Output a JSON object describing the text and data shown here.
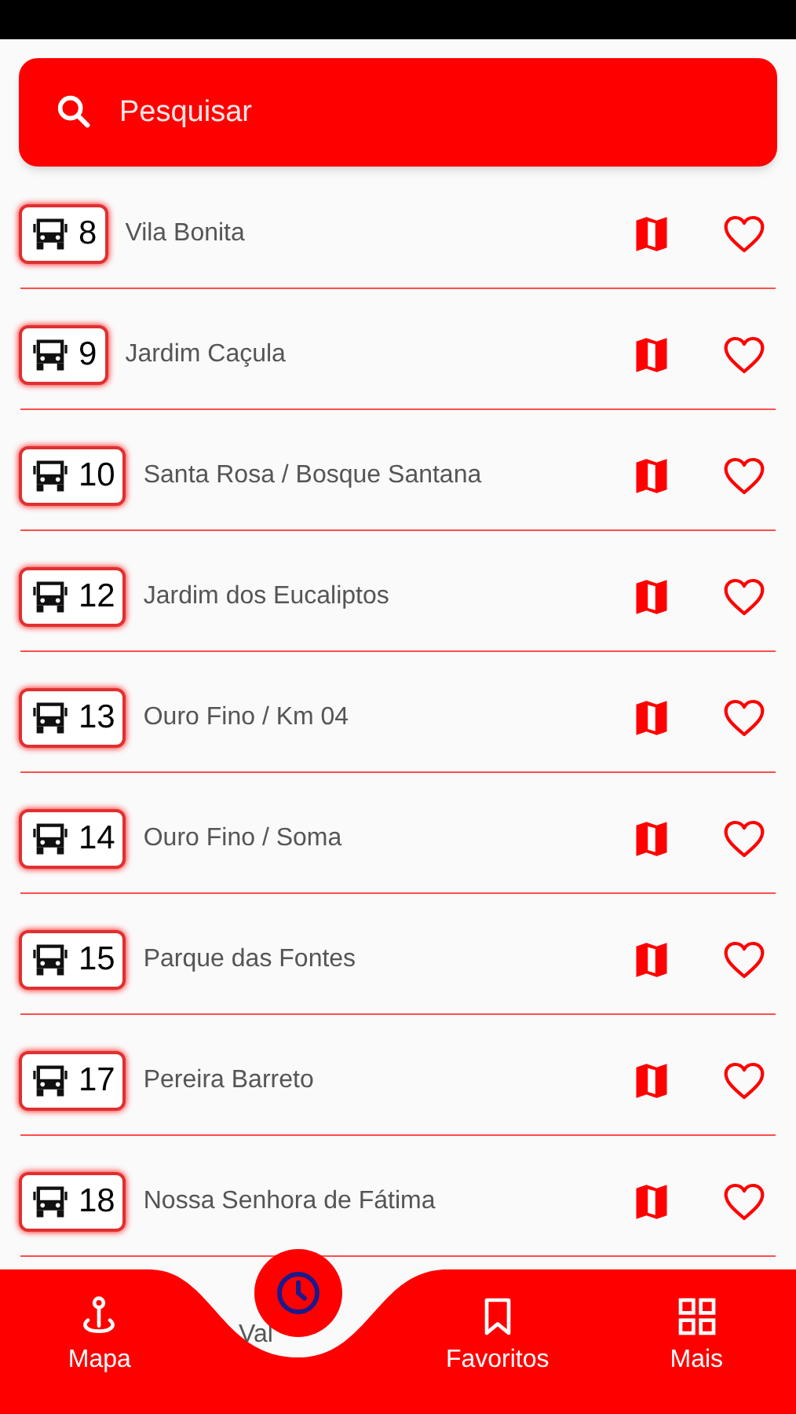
{
  "search": {
    "placeholder": "Pesquisar"
  },
  "routes": [
    {
      "number": "8",
      "name": "Vila Bonita"
    },
    {
      "number": "9",
      "name": "Jardim Caçula"
    },
    {
      "number": "10",
      "name": "Santa Rosa / Bosque Santana"
    },
    {
      "number": "12",
      "name": "Jardim dos Eucaliptos"
    },
    {
      "number": "13",
      "name": "Ouro Fino / Km 04"
    },
    {
      "number": "14",
      "name": "Ouro Fino / Soma"
    },
    {
      "number": "15",
      "name": "Parque das Fontes"
    },
    {
      "number": "17",
      "name": "Pereira Barreto"
    },
    {
      "number": "18",
      "name": "Nossa Senhora de Fátima"
    }
  ],
  "partial_route_name": "Val",
  "bottom_nav": [
    {
      "kind": "map",
      "label": "Mapa"
    },
    {
      "kind": "fab"
    },
    {
      "kind": "bookmark",
      "label": "Favoritos"
    },
    {
      "kind": "grid",
      "label": "Mais"
    }
  ]
}
